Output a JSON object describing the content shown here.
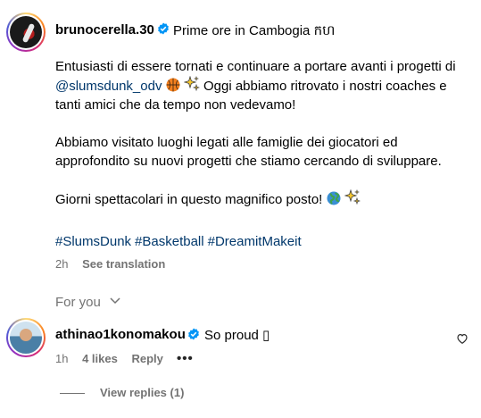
{
  "post": {
    "username": "brunocerella.30",
    "location": "Prime ore in Cambogia កហ",
    "caption": {
      "p1_before": "Entusiasti di essere tornati e continuare a portare avanti i progetti di ",
      "p1_mention": "@slumsdunk_odv",
      "p1_after": " Oggi abbiamo ritrovato i nostri coaches e tanti amici che da tempo non vedevamo!",
      "p2": "Abbiamo visitato luoghi legati alle famiglie dei giocatori ed approfondito su nuovi progetti che stiamo cercando di sviluppare.",
      "p3": "Giorni spettacolari in questo magnifico posto! "
    },
    "hashtags": [
      "#SlumsDunk",
      "#Basketball",
      "#DreamitMakeit"
    ],
    "time": "2h",
    "see_translation": "See translation"
  },
  "for_you": "For you",
  "comment": {
    "username": "athinao1konomakou",
    "text": "So proud ▯",
    "time": "1h",
    "likes": "4 likes",
    "reply": "Reply",
    "view_replies": "View replies (1)"
  },
  "icons": {
    "verified": "verified-badge-icon",
    "heart": "heart-outline-icon",
    "more": "more-dots-icon",
    "chevron": "chevron-down-icon",
    "basketball": "basketball-emoji-icon",
    "sparkles": "sparkles-emoji-icon",
    "globe": "globe-emoji-icon"
  },
  "colors": {
    "link": "#00376b",
    "secondary": "#737373",
    "verified": "#0095f6"
  }
}
